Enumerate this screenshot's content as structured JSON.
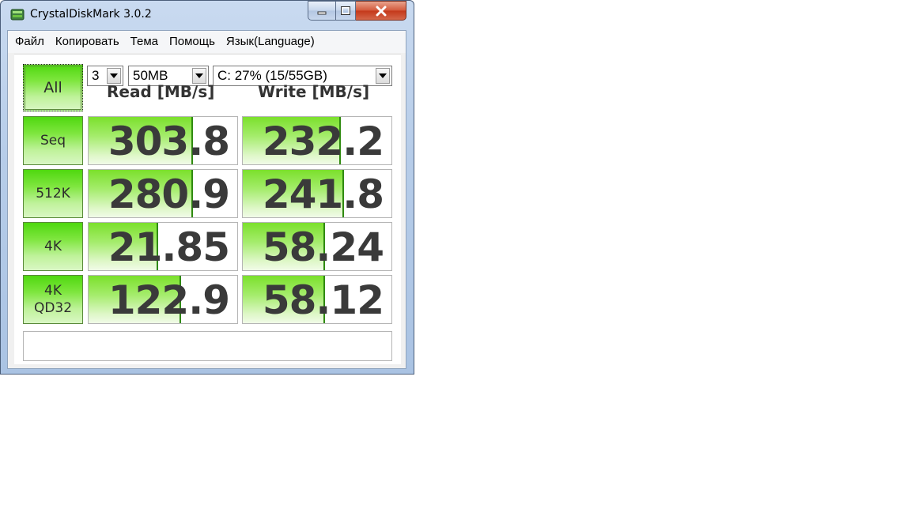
{
  "window": {
    "title": "CrystalDiskMark 3.0.2",
    "icon": "crystaldiskmark-app-icon"
  },
  "menu": [
    "Файл",
    "Копировать",
    "Тема",
    "Помощь",
    "Язык(Language)"
  ],
  "controls": {
    "all_label": "All",
    "count": "3",
    "size": "50MB",
    "drive": "C: 27% (15/55GB)"
  },
  "headers": {
    "read": "Read [MB/s]",
    "write": "Write [MB/s]"
  },
  "rows": [
    {
      "label": "Seq",
      "read": "303.8",
      "write": "232.2",
      "read_fill": 0.69,
      "write_fill": 0.65
    },
    {
      "label": "512K",
      "read": "280.9",
      "write": "241.8",
      "read_fill": 0.69,
      "write_fill": 0.67
    },
    {
      "label": "4K",
      "read": "21.85",
      "write": "58.24",
      "read_fill": 0.46,
      "write_fill": 0.54
    },
    {
      "label": "4K\nQD32",
      "read": "122.9",
      "write": "58.12",
      "read_fill": 0.61,
      "write_fill": 0.54
    }
  ],
  "status_text": "",
  "colors": {
    "accent_green": "#4fd80f",
    "bar_edge": "#2f8a10",
    "close": "#c4381a"
  }
}
